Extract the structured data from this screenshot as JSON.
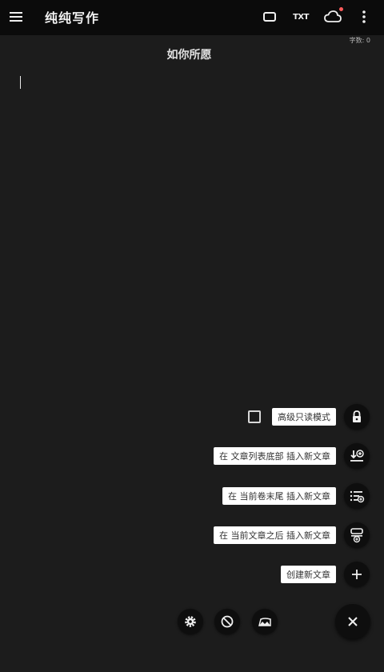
{
  "app": {
    "title": "纯纯写作"
  },
  "toolbar": {
    "icons": [
      "menu-icon",
      "fullscreen-icon",
      "txt-icon",
      "cloud-sync-icon",
      "more-vert-icon"
    ],
    "txt_label": "TXT",
    "cloud_badge_color": "#ff5b5b"
  },
  "editor": {
    "word_count": "字数: 0",
    "title": "如你所愿",
    "content": ""
  },
  "fab_menu": {
    "readonly_label": "高级只读模式",
    "insert_list_bottom_label": "在 文章列表底部 插入新文章",
    "insert_volume_end_label": "在 当前卷末尾 插入新文章",
    "insert_after_current_label": "在 当前文章之后 插入新文章",
    "create_new_label": "创建新文章"
  },
  "bottom_actions": [
    "settings-icon",
    "block-icon",
    "theme-icon",
    "close-icon"
  ],
  "colors": {
    "background": "#1c1c1c",
    "topbar": "#0b0b0b",
    "fab": "#0e0e0e",
    "label_bg": "#ffffff"
  }
}
